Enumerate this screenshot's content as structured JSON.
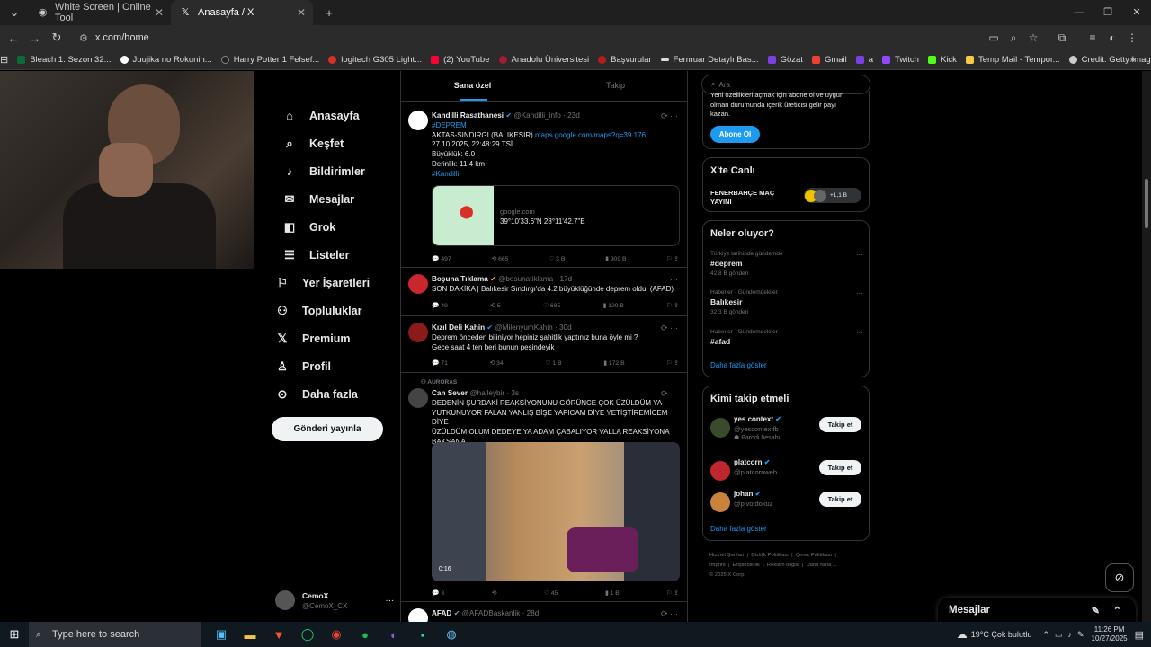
{
  "browser": {
    "tabs": [
      {
        "label": "White Screen | Online Tool",
        "active": false
      },
      {
        "label": "Anasayfa / X",
        "active": true
      }
    ],
    "url": "x.com/home",
    "bookmarks": [
      "Bleach 1. Sezon 32...",
      "Juujika no Rokunin...",
      "Harry Potter 1 Felsef...",
      "logitech G305 Light...",
      "(2) YouTube",
      "Anadolu Üniversitesi",
      "Başvurular",
      "Fermuar Detaylı Bas...",
      "Gözat",
      "Gmail",
      "a",
      "Twitch",
      "Kick",
      "Temp Mail - Tempor...",
      "Credit: Getty Image..."
    ]
  },
  "leftnav": {
    "items": [
      "Anasayfa",
      "Keşfet",
      "Bildirimler",
      "Mesajlar",
      "Grok",
      "Listeler",
      "Yer İşaretleri",
      "Topluluklar",
      "Premium",
      "Profil",
      "Daha fazla"
    ],
    "post_label": "Gönderi yayınla",
    "account_name": "CemoX",
    "account_handle": "@CemoX_CX"
  },
  "feed": {
    "tabs": [
      "Sana özel",
      "Takip"
    ],
    "tweets": [
      {
        "name": "Kandilli Rasathanesi",
        "handle": "@Kandilli_info · 23d",
        "lines": [
          "#DEPREM",
          "AKTAS-SINDIRGI (BALIKESIR)",
          "27.10.2025, 22:48:29 TSİ",
          "Büyüklük: 6.0",
          "Derinlik: 11.4 km",
          "#Kandilli"
        ],
        "link": "maps.google.com/maps?q=39.176,...",
        "card_domain": "google.com",
        "card_text": "39°10'33.6\"N 28°11'42.7\"E",
        "stats": [
          "497",
          "665",
          "3 B",
          "909 B"
        ]
      },
      {
        "name": "Boşuna Tıklama",
        "handle": "@bosunatiklama · 17d",
        "lines": [
          "SON DAKİKA | Balıkesir Sındırgı'da 4.2 büyüklüğünde deprem oldu. (AFAD)"
        ],
        "stats": [
          "49",
          "5",
          "685",
          "129 B"
        ]
      },
      {
        "name": "Kızıl Deli Kahin",
        "handle": "@MilenyumKahin · 30d",
        "lines": [
          "Deprem önceden biliniyor hepiniz şahitlik yaptınız buna öyle mi ?",
          "Gece saat 4 ten beri bunun peşindeyik"
        ],
        "stats": [
          "71",
          "34",
          "1 B",
          "172 B"
        ]
      },
      {
        "community": "AURORAS",
        "name": "Can Sever",
        "handle": "@halleybir · 3s",
        "lines": [
          "DEDENİN ŞURDAKİ REAKSİYONUNU GÖRÜNCE ÇOK ÜZÜLDÜM YA",
          "YUTKUNUYOR FALAN YANLIŞ BİŞE YAPICAM DİYE YETİŞTİREMİCEM DİYE",
          "ÜZÜLDÜM OLUM DEDEYE YA ADAM ÇABALIYOR VALLA REAKSİYONA",
          "BAKSANA"
        ],
        "media_time": "0:16",
        "stats": [
          "3",
          "",
          "45",
          "1 B"
        ]
      },
      {
        "name": "AFAD",
        "handle": "@AFADBaskanlik · 28d"
      }
    ]
  },
  "right": {
    "search_placeholder": "Ara",
    "premium_text": [
      "Yeni özellikleri açmak için abone ol ve uygun",
      "olman durumunda içerik üreticisi gelir payı",
      "kazan."
    ],
    "subscribe_label": "Abone Ol",
    "live_title": "X'te Canlı",
    "live_name": [
      "FENERBAHÇE MAÇ",
      "YAYINI"
    ],
    "live_count": "+1,1 B",
    "trends_title": "Neler oluyor?",
    "trends": [
      {
        "cat": "Türkiye tarihinde gündemde",
        "name": "#deprem",
        "count": "42,8 B gönderi"
      },
      {
        "cat": "Haberler · Gündemdekiler",
        "name": "Balıkesir",
        "count": "32,3 B gönderi"
      },
      {
        "cat": "Haberler · Gündemdekiler",
        "name": "#afad",
        "count": ""
      }
    ],
    "show_more": "Daha fazla göster",
    "who_title": "Kimi takip etmeli",
    "who": [
      {
        "name": "yes context",
        "handle": "@yescontextfb",
        "extra": "Parodi hesabı",
        "color": "#3c4a2c"
      },
      {
        "name": "platcorn",
        "handle": "@platcornweb",
        "extra": "",
        "color": "#c0262d"
      },
      {
        "name": "johan",
        "handle": "@pivotdokuz",
        "extra": "",
        "color": "#c9823b"
      }
    ],
    "follow_label": "Takip et",
    "footer": [
      "Hizmet Şartları",
      "Gizlilik Politikası",
      "Çerez Politikası",
      "Imprint",
      "Erişilebilirlik",
      "Reklam bilgisi",
      "Daha fazla ...",
      "© 2025 X Corp."
    ]
  },
  "messages_label": "Mesajlar",
  "taskbar": {
    "search": "Type here to search",
    "weather": "19°C  Çok bulutlu",
    "time": "11:26 PM",
    "date": "10/27/2025"
  }
}
